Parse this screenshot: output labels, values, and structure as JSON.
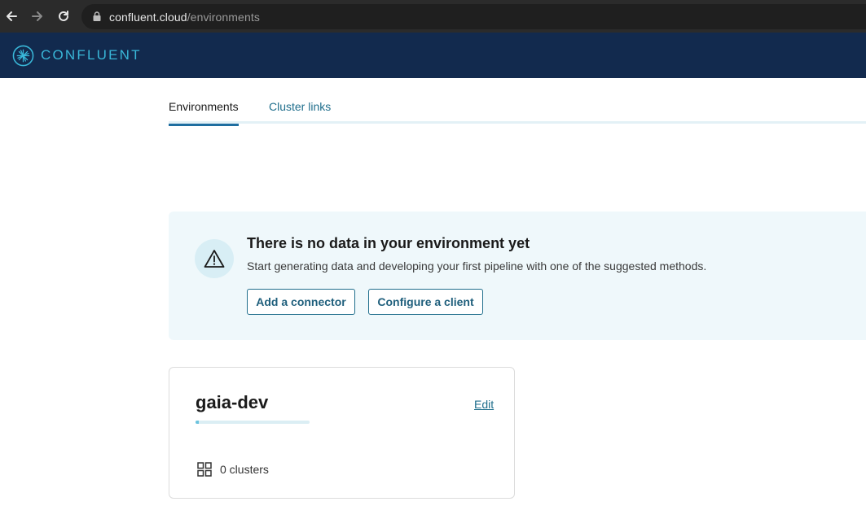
{
  "browser": {
    "url_host": "confluent.cloud",
    "url_path": "/environments",
    "icons": [
      "back-arrow-icon",
      "forward-arrow-icon",
      "reload-icon",
      "lock-icon"
    ]
  },
  "header": {
    "logo_text": "CONFLUENT",
    "background": "#122a4e",
    "accent": "#39b7d8"
  },
  "tabs": [
    {
      "label": "Environments",
      "active": true
    },
    {
      "label": "Cluster links",
      "active": false
    }
  ],
  "banner": {
    "icon": "warning-icon",
    "title": "There is no data in your environment yet",
    "description": "Start generating data and developing your first pipeline with one of the suggested methods.",
    "buttons": {
      "add_connector": "Add a connector",
      "configure_client": "Configure a client"
    }
  },
  "environment_card": {
    "name": "gaia-dev",
    "edit_label": "Edit",
    "usage_fraction": 0.03,
    "clusters_text": "0 clusters",
    "clusters_icon": "grid-icon"
  }
}
